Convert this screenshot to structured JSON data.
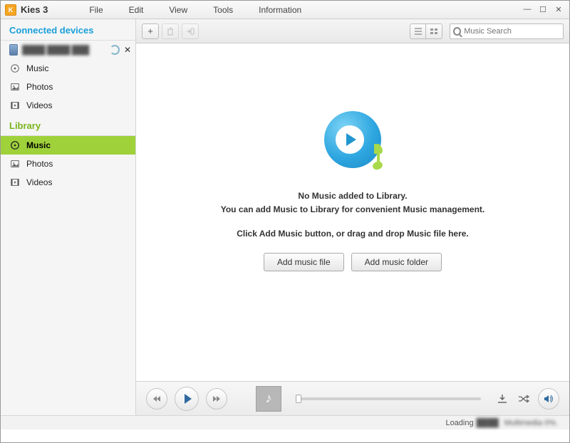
{
  "app": {
    "title": "Kies 3"
  },
  "menu": {
    "file": "File",
    "edit": "Edit",
    "view": "View",
    "tools": "Tools",
    "info": "Information"
  },
  "window": {
    "minimize": "—",
    "maximize": "☐",
    "close": "✕"
  },
  "sidebar": {
    "connected_header": "Connected devices",
    "device": {
      "name": "████ ████ ███",
      "close": "✕"
    },
    "device_items": [
      {
        "label": "Music",
        "icon": "music-icon"
      },
      {
        "label": "Photos",
        "icon": "photos-icon"
      },
      {
        "label": "Videos",
        "icon": "videos-icon"
      }
    ],
    "library_header": "Library",
    "library_items": [
      {
        "label": "Music",
        "icon": "music-icon",
        "selected": true
      },
      {
        "label": "Photos",
        "icon": "photos-icon"
      },
      {
        "label": "Videos",
        "icon": "videos-icon"
      }
    ]
  },
  "toolbar": {
    "add": "+",
    "search_placeholder": "Music Search"
  },
  "empty": {
    "line1": "No Music added to Library.",
    "line2": "You can add Music to Library for convenient Music management.",
    "line3": "Click Add Music button, or drag and drop Music file here.",
    "add_file": "Add music file",
    "add_folder": "Add music folder"
  },
  "status": {
    "loading": "Loading",
    "middle": "████",
    "tail": "Multimedia 0%."
  },
  "icons": {
    "list": "≡",
    "grid": "⊞",
    "repeat": "⟲",
    "shuffle": "✕",
    "shuffle2": "⤨",
    "download": "⬇",
    "volume": "🔊",
    "note": "♪"
  }
}
